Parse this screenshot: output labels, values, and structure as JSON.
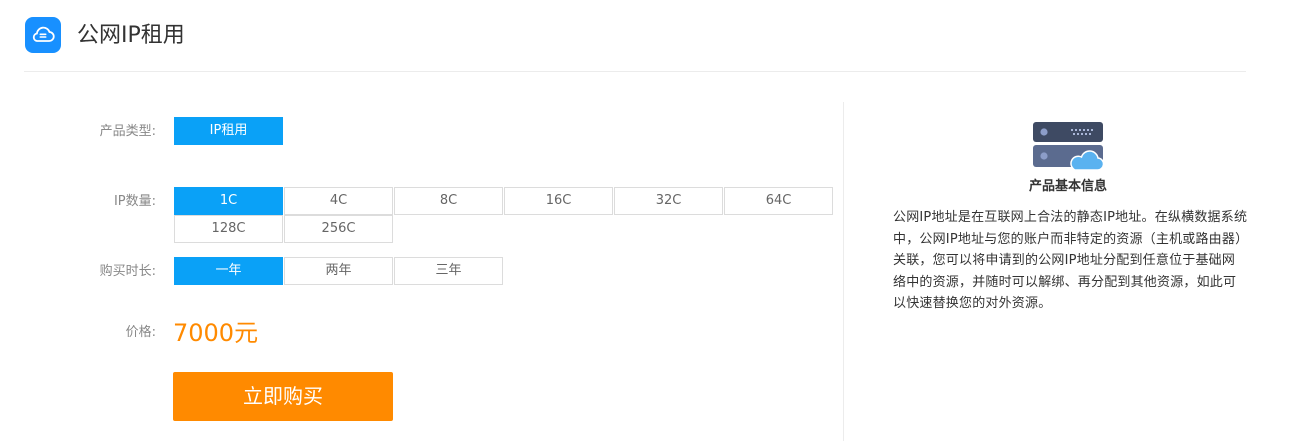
{
  "header": {
    "title": "公网IP租用",
    "icon": "cloud-storage-icon"
  },
  "form": {
    "product_type": {
      "label": "产品类型:",
      "options": [
        "IP租用"
      ],
      "selected": "IP租用"
    },
    "ip_count": {
      "label": "IP数量:",
      "options": [
        "1C",
        "4C",
        "8C",
        "16C",
        "32C",
        "64C",
        "128C",
        "256C"
      ],
      "selected": "1C"
    },
    "duration": {
      "label": "购买时长:",
      "options": [
        "一年",
        "两年",
        "三年"
      ],
      "selected": "一年"
    },
    "price": {
      "label": "价格:",
      "value": "7000元"
    },
    "buy_button": "立即购买"
  },
  "info": {
    "icon": "server-cloud-icon",
    "title": "产品基本信息",
    "description": "公网IP地址是在互联网上合法的静态IP地址。在纵横数据系统中，公网IP地址与您的账户而非特定的资源（主机或路由器）关联，您可以将申请到的公网IP地址分配到任意位于基础网络中的资源，并随时可以解绑、再分配到其他资源，如此可以快速替换您的对外资源。"
  },
  "colors": {
    "accent": "#0aa1f7",
    "price": "#ff8a00",
    "buy_button": "#ff8a00",
    "brand": "#1890ff"
  }
}
